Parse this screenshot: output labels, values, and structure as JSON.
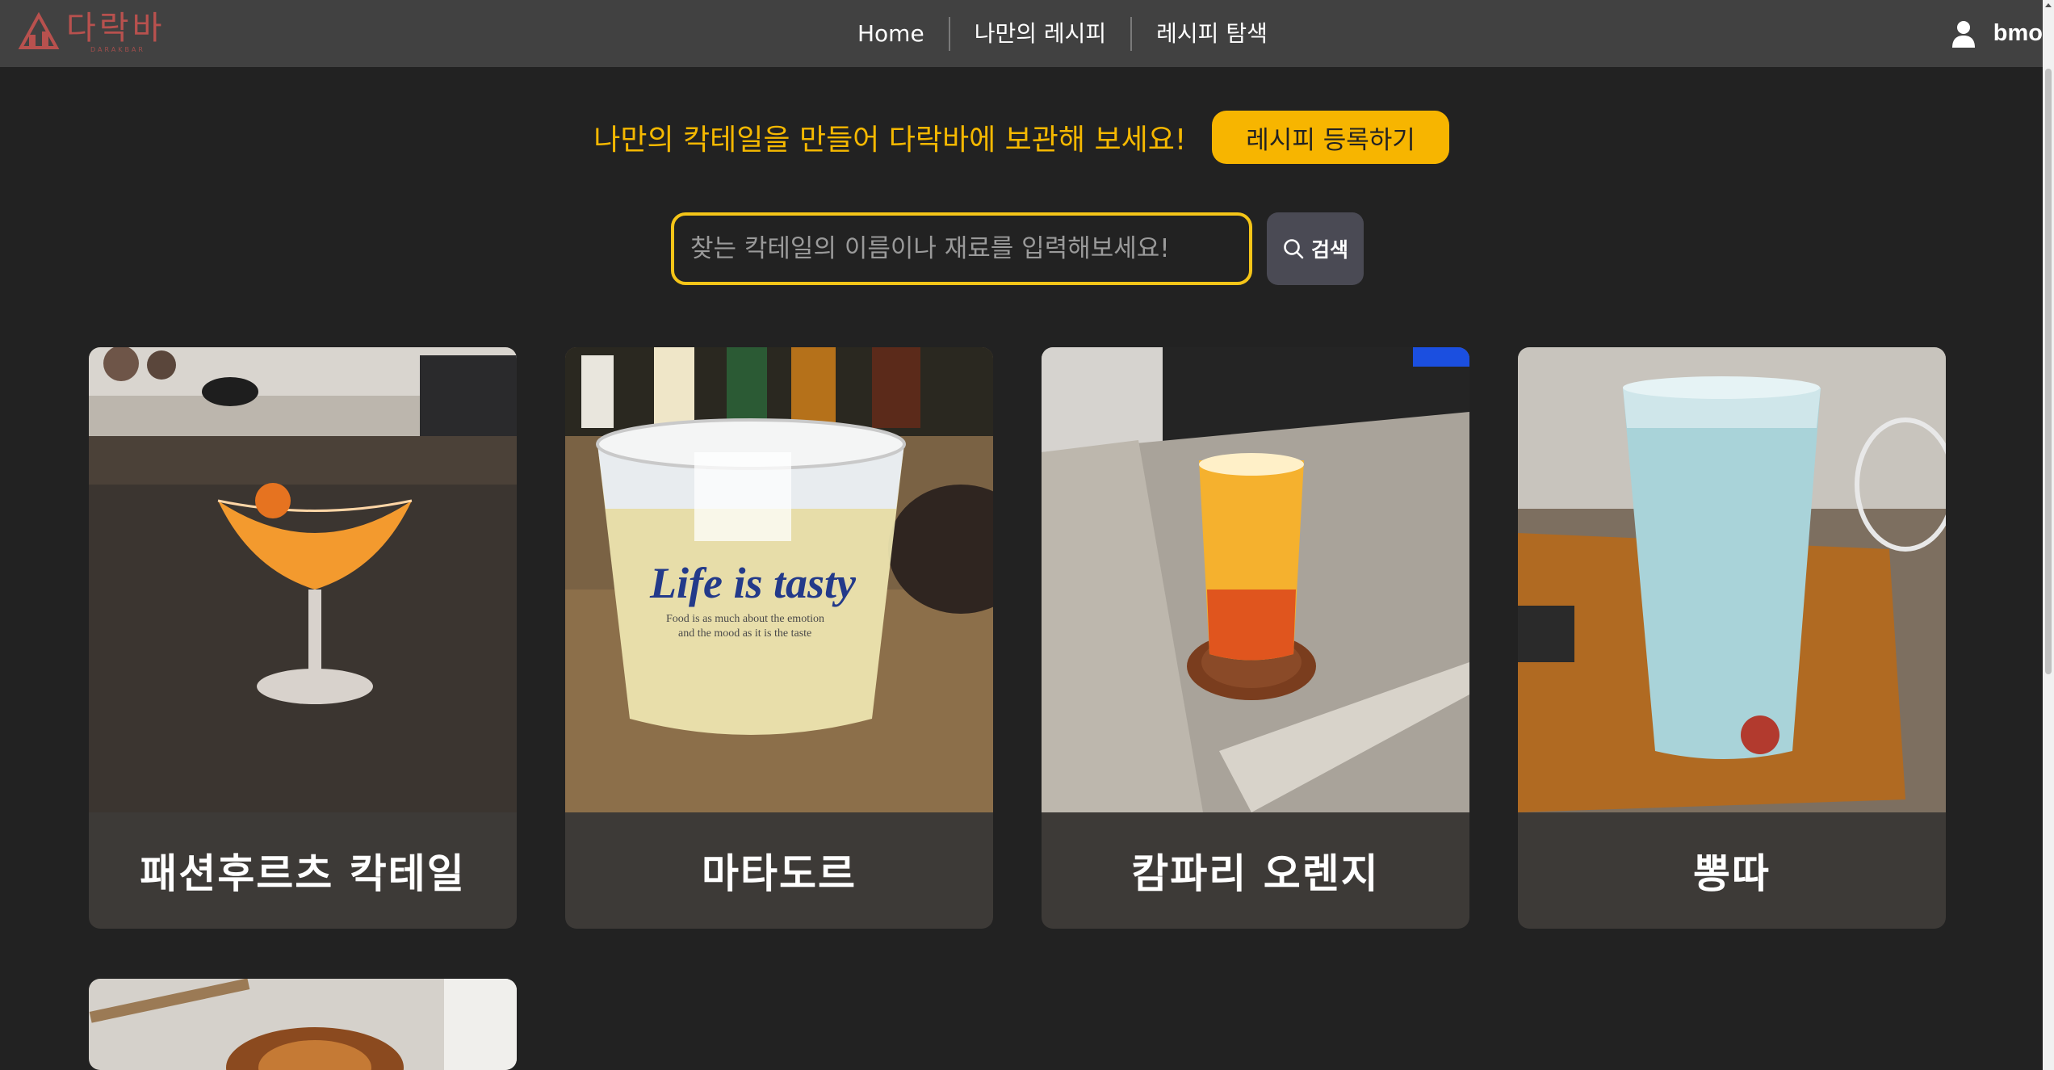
{
  "header": {
    "logo_text": "다락바",
    "logo_subtext": "DARAKBAR",
    "nav": [
      {
        "label": "Home"
      },
      {
        "label": "나만의 레시피"
      },
      {
        "label": "레시피 탐색"
      }
    ],
    "user_name": "bmo"
  },
  "promo": {
    "text": "나만의 칵테일을 만들어 다락바에 보관해 보세요!",
    "button_label": "레시피 등록하기"
  },
  "search": {
    "placeholder": "찾는 칵테일의 이름이나 재료를 입력해보세요!",
    "button_label": "검색"
  },
  "cards": [
    {
      "title": "패션후르츠 칵테일",
      "image_icon": "orange-martini-image"
    },
    {
      "title": "마타도르",
      "image_icon": "yellow-glass-image"
    },
    {
      "title": "캄파리 오렌지",
      "image_icon": "orange-highball-image"
    },
    {
      "title": "뽕따",
      "image_icon": "blue-pint-image"
    },
    {
      "title": "",
      "image_icon": "dried-orange-image"
    }
  ],
  "colors": {
    "accent": "#f7b500",
    "header_bg": "#414141",
    "page_bg": "#222222",
    "card_bg": "#3d3a37"
  }
}
